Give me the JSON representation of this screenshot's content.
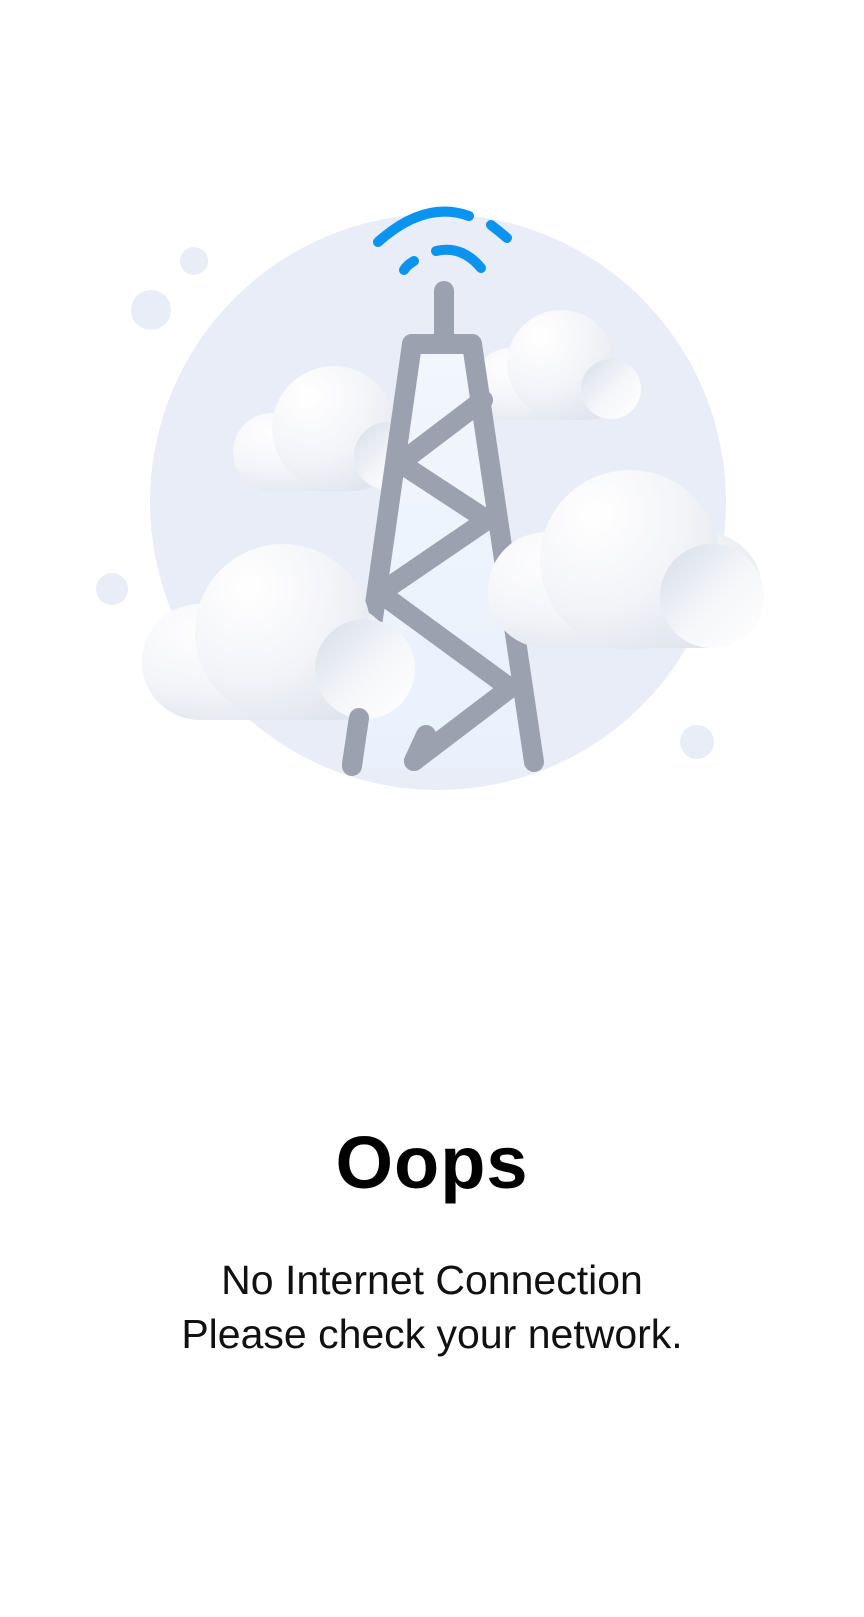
{
  "illustration": {
    "icon": "cell-tower-no-signal-icon",
    "colors": {
      "circle": "#E8EDF7",
      "tower": "#9CA1B0",
      "signal": "#0B93F0",
      "cloud": "#F4F5F8"
    }
  },
  "error": {
    "title": "Oops",
    "line1": "No Internet Connection",
    "line2": "Please check your network."
  }
}
